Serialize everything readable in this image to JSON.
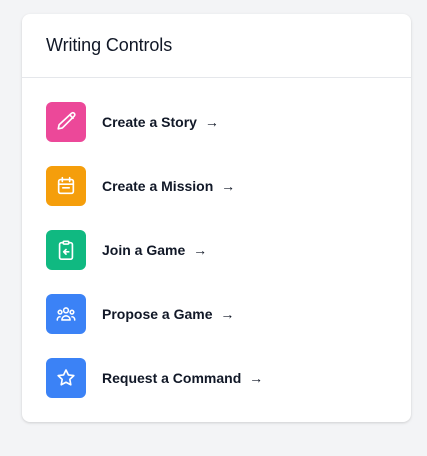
{
  "card": {
    "title": "Writing Controls"
  },
  "items": [
    {
      "label": "Create a Story",
      "arrow": "→",
      "icon": "pencil-icon",
      "color": "#ec4899"
    },
    {
      "label": "Create a Mission",
      "arrow": "→",
      "icon": "calendar-icon",
      "color": "#f59e0b"
    },
    {
      "label": "Join a Game",
      "arrow": "→",
      "icon": "clipboard-enter-icon",
      "color": "#10b981"
    },
    {
      "label": "Propose a Game",
      "arrow": "→",
      "icon": "user-group-icon",
      "color": "#3b82f6"
    },
    {
      "label": "Request a Command",
      "arrow": "→",
      "icon": "star-icon",
      "color": "#3b82f6"
    }
  ]
}
